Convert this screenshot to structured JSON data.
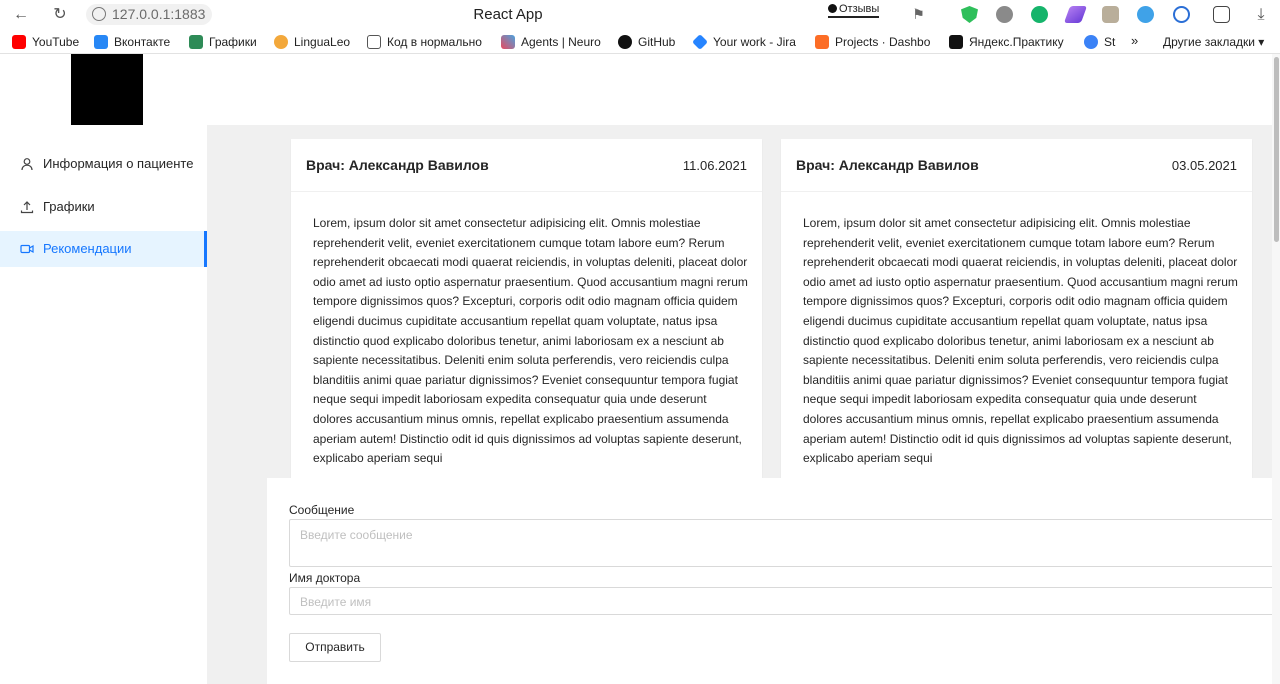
{
  "browser": {
    "url": "127.0.0.1:1883",
    "tab_title": "React App",
    "feedback_label": "Отзывы",
    "bookmarks": [
      "YouTube",
      "Вконтакте",
      "Графики",
      "LinguaLeo",
      "Код в нормальнo",
      "Agents | Neuro",
      "GitHub",
      "Your work - Jira",
      "Projects · Dashbo",
      "Яндекс.Практику",
      "St"
    ],
    "more_bookmarks": "»",
    "other_bookmarks": "Другие закладки ▾"
  },
  "sidebar": {
    "items": [
      {
        "label": "Информация о пациенте",
        "icon": "user-icon"
      },
      {
        "label": "Графики",
        "icon": "upload-icon"
      },
      {
        "label": "Рекомендации",
        "icon": "video-camera-icon",
        "active": true
      }
    ]
  },
  "cards": [
    {
      "doctor": "Врач: Александр Вавилов",
      "date": "11.06.2021",
      "text": "Lorem, ipsum dolor sit amet consectetur adipisicing elit. Omnis molestiae reprehenderit velit, eveniet exercitationem cumque totam labore eum? Rerum reprehenderit obcaecati modi quaerat reiciendis, in voluptas deleniti, placeat dolor odio amet ad iusto optio aspernatur praesentium. Quod accusantium magni rerum tempore dignissimos quos? Excepturi, corporis odit odio magnam officia quidem eligendi ducimus cupiditate accusantium repellat quam voluptate, natus ipsa distinctio quod explicabo doloribus tenetur, animi laboriosam ex a nesciunt ab sapiente necessitatibus. Deleniti enim soluta perferendis, vero reiciendis culpa blanditiis animi quae pariatur dignissimos? Eveniet consequuntur tempora fugiat neque sequi impedit laboriosam expedita consequatur quia unde deserunt dolores accusantium minus omnis, repellat explicabo praesentium assumenda aperiam autem! Distinctio odit id quis dignissimos ad voluptas sapiente deserunt, explicabo aperiam sequi"
    },
    {
      "doctor": "Врач: Александр Вавилов",
      "date": "03.05.2021",
      "text": "Lorem, ipsum dolor sit amet consectetur adipisicing elit. Omnis molestiae reprehenderit velit, eveniet exercitationem cumque totam labore eum? Rerum reprehenderit obcaecati modi quaerat reiciendis, in voluptas deleniti, placeat dolor odio amet ad iusto optio aspernatur praesentium. Quod accusantium magni rerum tempore dignissimos quos? Excepturi, corporis odit odio magnam officia quidem eligendi ducimus cupiditate accusantium repellat quam voluptate, natus ipsa distinctio quod explicabo doloribus tenetur, animi laboriosam ex a nesciunt ab sapiente necessitatibus. Deleniti enim soluta perferendis, vero reiciendis culpa blanditiis animi quae pariatur dignissimos? Eveniet consequuntur tempora fugiat neque sequi impedit laboriosam expedita consequatur quia unde deserunt dolores accusantium minus omnis, repellat explicabo praesentium assumenda aperiam autem! Distinctio odit id quis dignissimos ad voluptas sapiente deserunt, explicabo aperiam sequi"
    }
  ],
  "form": {
    "message_label": "Сообщение",
    "message_placeholder": "Введите сообщение",
    "doctor_label": "Имя доктора",
    "doctor_placeholder": "Введите имя",
    "submit_label": "Отправить"
  },
  "colors": {
    "accent": "#1677ff",
    "active_bg": "#e6f4ff",
    "content_bg": "#f0f0f0"
  }
}
